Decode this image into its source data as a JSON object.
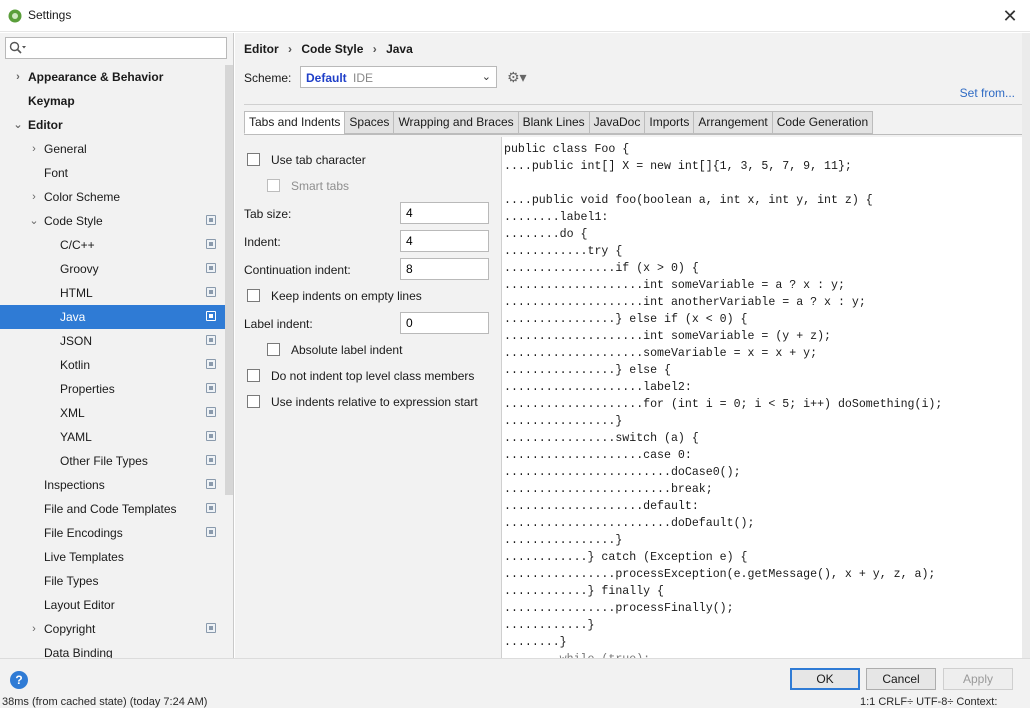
{
  "window": {
    "title": "Settings",
    "close": "✕"
  },
  "search": {
    "placeholder": ""
  },
  "tree": [
    {
      "label": "Appearance & Behavior",
      "level": 0,
      "arrow": "›",
      "bold": true,
      "scope": false
    },
    {
      "label": "Keymap",
      "level": 0,
      "arrow": "",
      "bold": true,
      "scope": false
    },
    {
      "label": "Editor",
      "level": 0,
      "arrow": "⌄",
      "bold": true,
      "scope": false
    },
    {
      "label": "General",
      "level": 1,
      "arrow": "›",
      "bold": false,
      "scope": false
    },
    {
      "label": "Font",
      "level": 1,
      "arrow": "",
      "bold": false,
      "scope": false
    },
    {
      "label": "Color Scheme",
      "level": 1,
      "arrow": "›",
      "bold": false,
      "scope": false
    },
    {
      "label": "Code Style",
      "level": 1,
      "arrow": "⌄",
      "bold": false,
      "scope": true
    },
    {
      "label": "C/C++",
      "level": 2,
      "arrow": "",
      "bold": false,
      "scope": true
    },
    {
      "label": "Groovy",
      "level": 2,
      "arrow": "",
      "bold": false,
      "scope": true
    },
    {
      "label": "HTML",
      "level": 2,
      "arrow": "",
      "bold": false,
      "scope": true
    },
    {
      "label": "Java",
      "level": 2,
      "arrow": "",
      "bold": false,
      "scope": true,
      "selected": true
    },
    {
      "label": "JSON",
      "level": 2,
      "arrow": "",
      "bold": false,
      "scope": true
    },
    {
      "label": "Kotlin",
      "level": 2,
      "arrow": "",
      "bold": false,
      "scope": true
    },
    {
      "label": "Properties",
      "level": 2,
      "arrow": "",
      "bold": false,
      "scope": true
    },
    {
      "label": "XML",
      "level": 2,
      "arrow": "",
      "bold": false,
      "scope": true
    },
    {
      "label": "YAML",
      "level": 2,
      "arrow": "",
      "bold": false,
      "scope": true
    },
    {
      "label": "Other File Types",
      "level": 2,
      "arrow": "",
      "bold": false,
      "scope": true
    },
    {
      "label": "Inspections",
      "level": 1,
      "arrow": "",
      "bold": false,
      "scope": true
    },
    {
      "label": "File and Code Templates",
      "level": 1,
      "arrow": "",
      "bold": false,
      "scope": true
    },
    {
      "label": "File Encodings",
      "level": 1,
      "arrow": "",
      "bold": false,
      "scope": true
    },
    {
      "label": "Live Templates",
      "level": 1,
      "arrow": "",
      "bold": false,
      "scope": false
    },
    {
      "label": "File Types",
      "level": 1,
      "arrow": "",
      "bold": false,
      "scope": false
    },
    {
      "label": "Layout Editor",
      "level": 1,
      "arrow": "",
      "bold": false,
      "scope": false
    },
    {
      "label": "Copyright",
      "level": 1,
      "arrow": "›",
      "bold": false,
      "scope": true
    },
    {
      "label": "Data Binding",
      "level": 1,
      "arrow": "",
      "bold": false,
      "scope": false
    }
  ],
  "breadcrumb": {
    "editor": "Editor",
    "code_style": "Code Style",
    "java": "Java",
    "sep": "›"
  },
  "scheme": {
    "label": "Scheme:",
    "name": "Default",
    "kind": "IDE",
    "dropdown": "⌄",
    "gear": "⚙▾"
  },
  "set_from": "Set from...",
  "tabs": [
    "Tabs and Indents",
    "Spaces",
    "Wrapping and Braces",
    "Blank Lines",
    "JavaDoc",
    "Imports",
    "Arrangement",
    "Code Generation"
  ],
  "form": {
    "use_tab_character": "Use tab character",
    "smart_tabs": "Smart tabs",
    "tab_size_label": "Tab size:",
    "tab_size": "4",
    "indent_label": "Indent:",
    "indent": "4",
    "continuation_label": "Continuation indent:",
    "continuation": "8",
    "keep_indents": "Keep indents on empty lines",
    "label_indent_label": "Label indent:",
    "label_indent": "0",
    "absolute_label": "Absolute label indent",
    "no_indent_top": "Do not indent top level class members",
    "use_relative": "Use indents relative to expression start"
  },
  "code_lines": [
    "public class Foo {",
    "....public int[] X = new int[]{1, 3, 5, 7, 9, 11};",
    "",
    "....public void foo(boolean a, int x, int y, int z) {",
    "........label1:",
    "........do {",
    "............try {",
    "................if (x > 0) {",
    "....................int someVariable = a ? x : y;",
    "....................int anotherVariable = a ? x : y;",
    "................} else if (x < 0) {",
    "....................int someVariable = (y + z);",
    "....................someVariable = x = x + y;",
    "................} else {",
    "....................label2:",
    "....................for (int i = 0; i < 5; i++) doSomething(i);",
    "................}",
    "................switch (a) {",
    "....................case 0:",
    "........................doCase0();",
    "........................break;",
    "....................default:",
    "........................doDefault();",
    "................}",
    "............} catch (Exception e) {",
    "................processException(e.getMessage(), x + y, z, a);",
    "............} finally {",
    "................processFinally();",
    "............}",
    "........}",
    "........while (true);"
  ],
  "footer": {
    "help": "?",
    "ok": "OK",
    "cancel": "Cancel",
    "apply": "Apply"
  },
  "status": {
    "left": "38ms (from cached state) (today 7:24 AM)",
    "right": "1:1   CRLF÷   UTF-8÷   Context:"
  }
}
